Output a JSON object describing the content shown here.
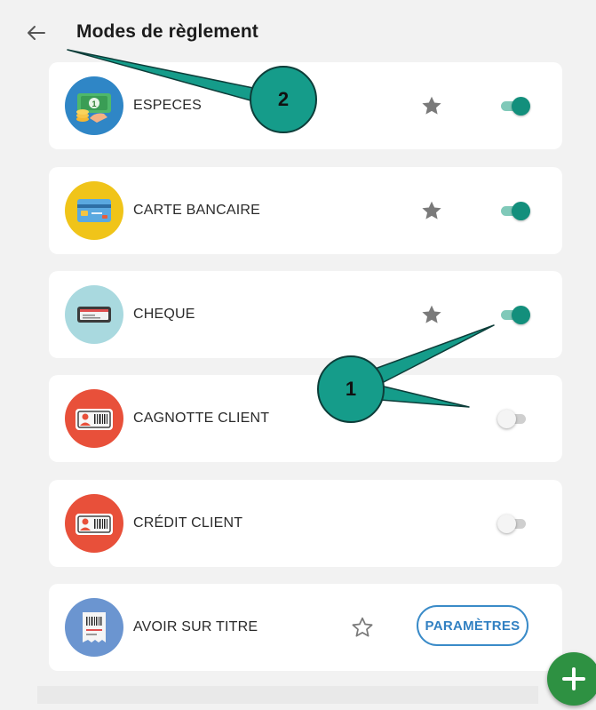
{
  "header": {
    "title": "Modes de règlement",
    "back_icon": "arrow-left-icon"
  },
  "payment_methods": [
    {
      "label": "ESPECES",
      "icon": "cash-icon",
      "icon_bg": "#2f86c6",
      "favorite": true,
      "enabled": true
    },
    {
      "label": "CARTE BANCAIRE",
      "icon": "credit-card-icon",
      "icon_bg": "#f0c419",
      "favorite": true,
      "enabled": true
    },
    {
      "label": "CHEQUE",
      "icon": "cheque-icon",
      "icon_bg": "#a9d9df",
      "favorite": true,
      "enabled": true
    },
    {
      "label": "CAGNOTTE CLIENT",
      "icon": "customer-card-icon",
      "icon_bg": "#e8503a",
      "favorite": false,
      "enabled": false
    },
    {
      "label": "CRÉDIT CLIENT",
      "icon": "customer-card-icon",
      "icon_bg": "#e8503a",
      "favorite": false,
      "enabled": false
    },
    {
      "label": "AVOIR SUR TITRE",
      "icon": "voucher-icon",
      "icon_bg": "#6b95d0",
      "favorite": false,
      "settings_button": "PARAMÈTRES"
    }
  ],
  "annotations": [
    {
      "number": "1"
    },
    {
      "number": "2"
    }
  ],
  "fab": {
    "icon": "plus-icon"
  },
  "colors": {
    "accent": "#138f7c",
    "link": "#3180c2",
    "fab": "#2e9142",
    "annotation": "#159c8a"
  }
}
